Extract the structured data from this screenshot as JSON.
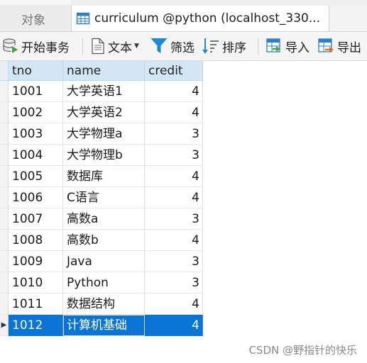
{
  "tabs": {
    "objects_label": "对象",
    "active_label": "curriculum @python (localhost_330..."
  },
  "toolbar": {
    "begin_transaction": "开始事务",
    "text": "文本",
    "filter": "筛选",
    "sort": "排序",
    "import": "导入",
    "export": "导出"
  },
  "grid": {
    "columns": [
      "tno",
      "name",
      "credit"
    ],
    "rows": [
      {
        "tno": "1001",
        "name": "大学英语1",
        "credit": "4"
      },
      {
        "tno": "1002",
        "name": "大学英语2",
        "credit": "4"
      },
      {
        "tno": "1003",
        "name": "大学物理a",
        "credit": "3"
      },
      {
        "tno": "1004",
        "name": "大学物理b",
        "credit": "3"
      },
      {
        "tno": "1005",
        "name": "数据库",
        "credit": "4"
      },
      {
        "tno": "1006",
        "name": "C语言",
        "credit": "4"
      },
      {
        "tno": "1007",
        "name": "高数a",
        "credit": "3"
      },
      {
        "tno": "1008",
        "name": "高数b",
        "credit": "4"
      },
      {
        "tno": "1009",
        "name": "Java",
        "credit": "3"
      },
      {
        "tno": "1010",
        "name": "Python",
        "credit": "3"
      },
      {
        "tno": "1011",
        "name": "数据结构",
        "credit": "4"
      },
      {
        "tno": "1012",
        "name": "计算机基础",
        "credit": "4"
      }
    ],
    "selected_row_index": 11
  },
  "watermark": "CSDN @野指针的快乐",
  "colors": {
    "header_bg": "#d4e6f6",
    "selection": "#0a74d6",
    "accent_icon": "#1e88d8"
  },
  "icons": {
    "table_tab": "table-icon",
    "begin_transaction": "transaction-icon",
    "text": "document-icon",
    "filter": "filter-icon",
    "sort": "sort-icon",
    "import": "import-icon",
    "export": "export-icon",
    "row_pointer": "row-pointer-icon"
  }
}
